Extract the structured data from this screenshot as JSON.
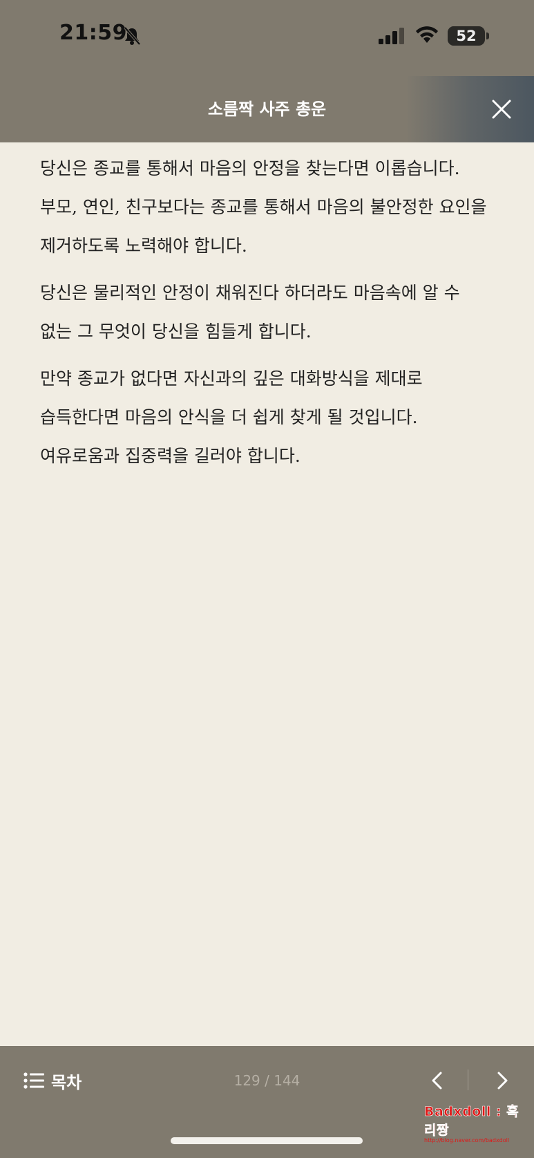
{
  "status_bar": {
    "time": "21:59",
    "battery": "52",
    "battery_level_percent": 52
  },
  "header": {
    "title": "소름짝 사주 총운"
  },
  "content": {
    "paragraphs": [
      "당신은 종교를 통해서 마음의 안정을 찾는다면 이롭습니다. 부모, 연인, 친구보다는 종교를 통해서 마음의 불안정한 요인을 제거하도록 노력해야 합니다.",
      "당신은 물리적인 안정이 채워진다 하더라도 마음속에 알 수 없는 그 무엇이 당신을 힘들게 합니다.",
      "만약 종교가 없다면 자신과의 깊은 대화방식을 제대로 습득한다면 마음의 안식을 더 쉽게 찾게 될 것입니다. 여유로움과 집중력을 길러야 합니다."
    ]
  },
  "footer": {
    "toc_label": "목차",
    "page_indicator": "129 / 144"
  },
  "watermark": {
    "text": "Badxdoll : 흑리짱",
    "url": "http://blog.naver.com/badxdoll"
  },
  "icons": {
    "bell": "bell-slash-icon",
    "signal": "cellular-signal-icon",
    "wifi": "wifi-icon",
    "close": "close-icon",
    "toc": "list-icon",
    "prev": "chevron-left-icon",
    "next": "chevron-right-icon"
  },
  "colors": {
    "bar_background": "#807a6e",
    "paper_background": "#f1ede3",
    "text": "#222222",
    "watermark_red": "#e01818"
  }
}
